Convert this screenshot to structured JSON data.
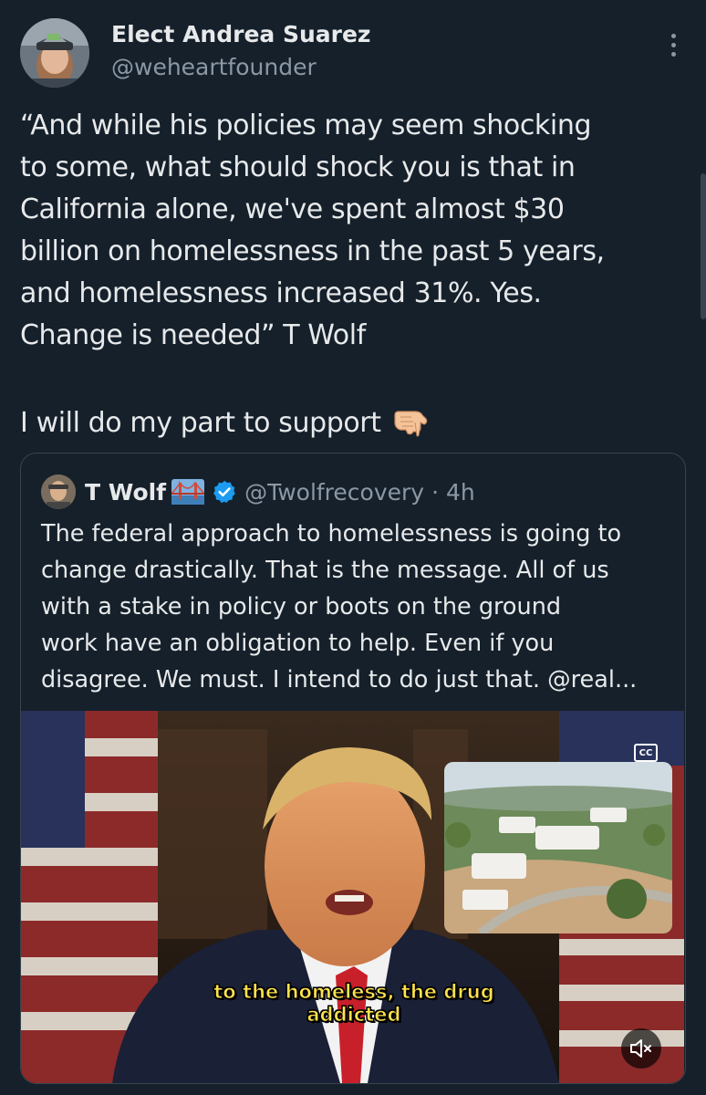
{
  "author": {
    "display_name": "Elect Andrea Suarez",
    "handle": "@weheartfounder"
  },
  "tweet": {
    "lines": [
      "“And while his policies may seem shocking",
      "to some, what should shock you is that in",
      "California alone, we've spent almost $30",
      "billion on homelessness in the past 5 years,",
      "and homelessness increased 31%. Yes.",
      "Change is needed” T Wolf"
    ],
    "support_text": "I will do my part to support",
    "support_emoji": "pointing-down-hand"
  },
  "quote": {
    "name": "T Wolf",
    "handle": "@Twolfrecovery",
    "time": "· 4h",
    "lines": [
      "The federal approach to homelessness is going to",
      "change drastically. That is the message. All of us",
      "with a stake in policy or boots on the ground",
      "work have an obligation to help. Even if you",
      "disagree. We must. I intend to do just that. @real..."
    ],
    "video": {
      "cc_label": "CC",
      "caption_lines": [
        "to the homeless, the drug",
        "addicted"
      ]
    }
  },
  "colors": {
    "background": "#15202b",
    "text_primary": "#e7e9ea",
    "text_secondary": "#8b98a5",
    "verified": "#1d9bf0",
    "caption": "#ffe34d"
  },
  "icons": [
    "more-options-icon",
    "pointing-down-icon",
    "bridge-emoji-icon",
    "verified-badge-icon",
    "closed-captions-icon",
    "muted-speaker-icon"
  ]
}
